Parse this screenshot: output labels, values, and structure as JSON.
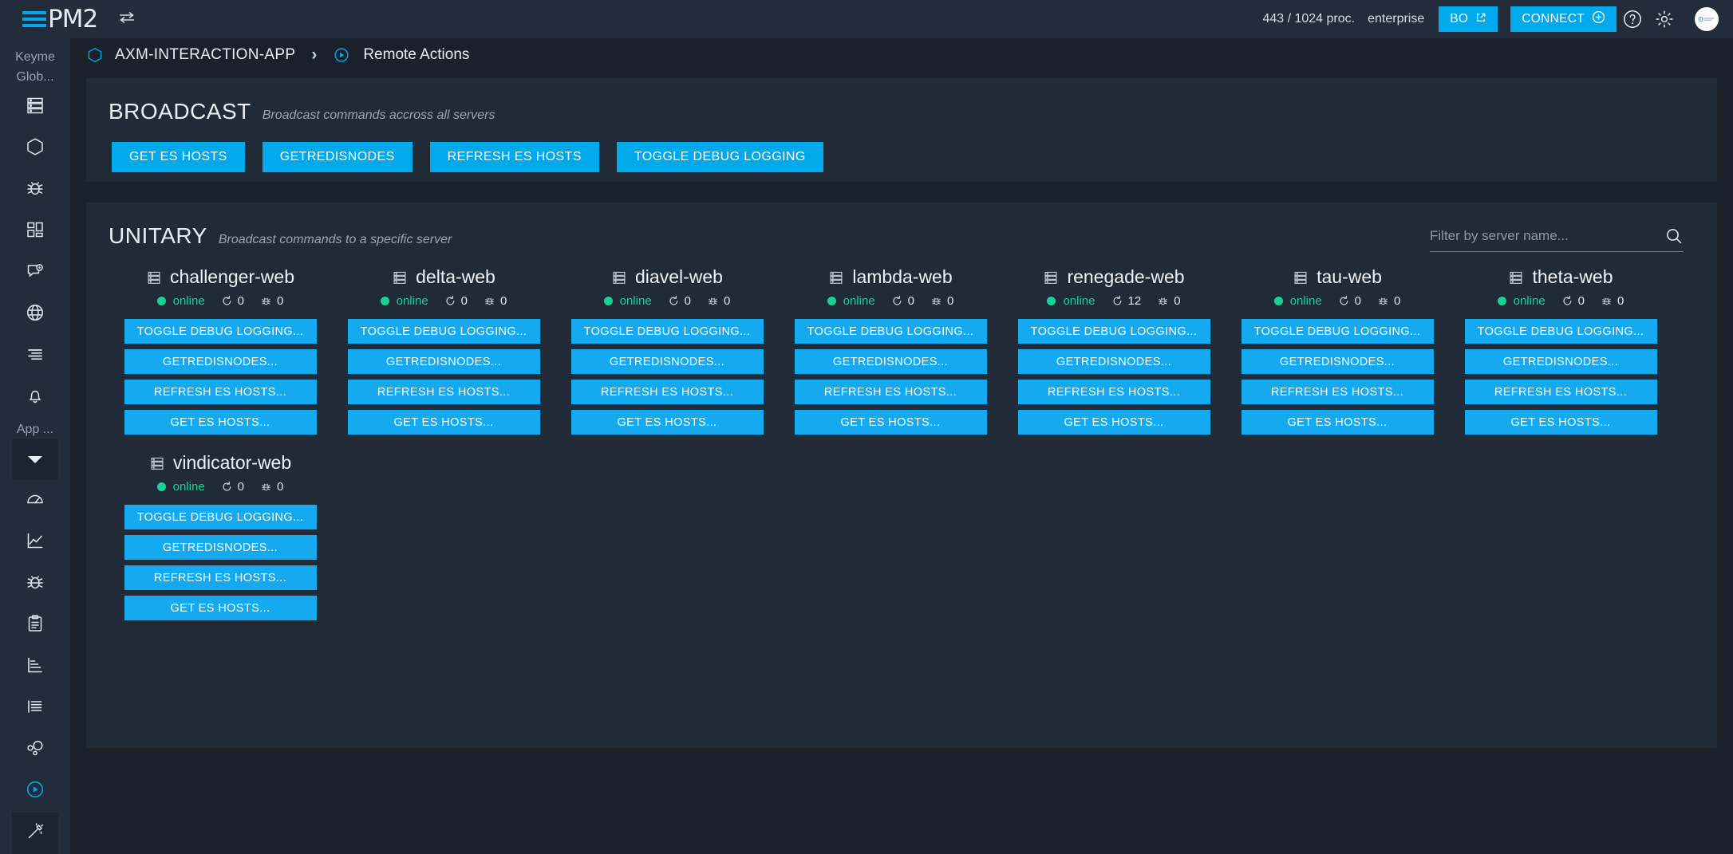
{
  "topbar": {
    "brand": "PM2",
    "swap_icon": "swap-horizontal-icon",
    "proc_count": "443 / 1024 proc.",
    "plan": "enterprise",
    "bo_label": "BO",
    "bo_icon": "external-link-icon",
    "connect_label": "CONNECT",
    "connect_icon": "plus-circle-icon",
    "help_icon": "help-circle-icon",
    "settings_icon": "gear-icon",
    "avatar": "user-avatar"
  },
  "sidebar": {
    "group_label_1": "Keyme",
    "group_label_2": "Glob...",
    "group_label_3": "App ...",
    "items": [
      {
        "name": "servers",
        "icon": "server-stack-icon"
      },
      {
        "name": "cluster",
        "icon": "hexagon-icon"
      },
      {
        "name": "issues",
        "icon": "bug-icon"
      },
      {
        "name": "dashboard",
        "icon": "grid-blocks-icon"
      },
      {
        "name": "monitoring",
        "icon": "chat-eye-icon"
      },
      {
        "name": "network",
        "icon": "globe-icon"
      },
      {
        "name": "logs",
        "icon": "lines-list-icon"
      },
      {
        "name": "alerts",
        "icon": "bell-icon"
      }
    ],
    "app_selector": {
      "name": "app-dropdown",
      "icon": "chevron-down-icon"
    },
    "app_items": [
      {
        "name": "metrics",
        "icon": "gauge-icon"
      },
      {
        "name": "charts",
        "icon": "line-chart-icon"
      },
      {
        "name": "app-issues",
        "icon": "bug-icon"
      },
      {
        "name": "tasks",
        "icon": "clipboard-icon"
      },
      {
        "name": "profiling",
        "icon": "bar-chart-icon"
      },
      {
        "name": "app-logs",
        "icon": "lines-icon"
      },
      {
        "name": "dependencies",
        "icon": "bubbles-icon"
      },
      {
        "name": "remote-actions",
        "icon": "play-circle-icon",
        "active": true
      },
      {
        "name": "console",
        "icon": "magic-wand-icon"
      }
    ]
  },
  "breadcrumb": {
    "app_icon": "hexagon-icon",
    "app_name": "AXM-INTERACTION-APP",
    "separator": "›",
    "page_icon": "play-circle-icon",
    "page_name": "Remote Actions"
  },
  "broadcast": {
    "title": "BROADCAST",
    "subtitle": "Broadcast commands accross all servers",
    "buttons": [
      "GET ES HOSTS",
      "GETREDISNODES",
      "REFRESH ES HOSTS",
      "TOGGLE DEBUG LOGGING"
    ]
  },
  "unitary": {
    "title": "UNITARY",
    "subtitle": "Broadcast commands to a specific server",
    "filter": {
      "value": "",
      "placeholder": "Filter by server name...",
      "icon": "search-icon"
    },
    "action_labels": [
      "TOGGLE DEBUG LOGGING...",
      "GETREDISNODES...",
      "REFRESH ES HOSTS...",
      "GET ES HOSTS..."
    ],
    "servers": [
      {
        "name": "challenger-web",
        "status": "online",
        "restarts": "0",
        "errors": "0"
      },
      {
        "name": "delta-web",
        "status": "online",
        "restarts": "0",
        "errors": "0"
      },
      {
        "name": "diavel-web",
        "status": "online",
        "restarts": "0",
        "errors": "0"
      },
      {
        "name": "lambda-web",
        "status": "online",
        "restarts": "0",
        "errors": "0"
      },
      {
        "name": "renegade-web",
        "status": "online",
        "restarts": "12",
        "errors": "0"
      },
      {
        "name": "tau-web",
        "status": "online",
        "restarts": "0",
        "errors": "0"
      },
      {
        "name": "theta-web",
        "status": "online",
        "restarts": "0",
        "errors": "0"
      },
      {
        "name": "vindicator-web",
        "status": "online",
        "restarts": "0",
        "errors": "0"
      }
    ]
  },
  "colors": {
    "accent": "#00a8ec",
    "button": "#15a9f0",
    "online": "#16d398",
    "page_bg": "#1a212b",
    "panel_bg": "#212b38",
    "chrome_bg": "#222c3b"
  }
}
